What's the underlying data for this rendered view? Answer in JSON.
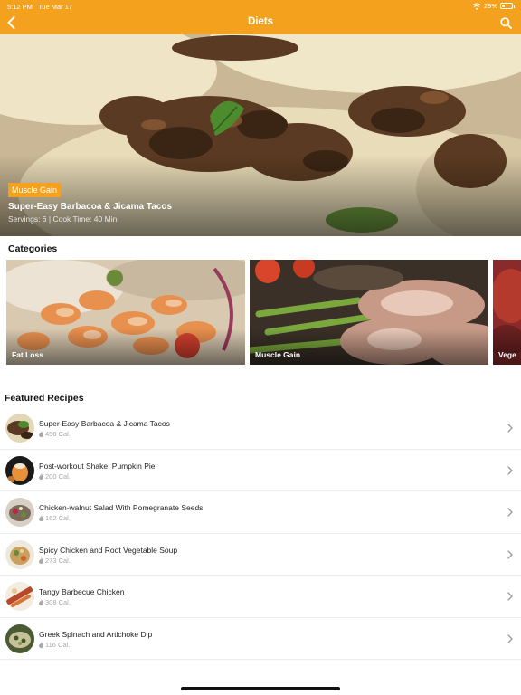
{
  "status_bar": {
    "time": "5:12 PM",
    "date": "Tue Mar 17",
    "battery": "29%",
    "battery_level": 0.29
  },
  "header": {
    "title": "Diets"
  },
  "featured": {
    "badge": "Muscle Gain",
    "title": "Super-Easy Barbacoa & Jicama Tacos",
    "meta": "Servings: 6 | Cook Time: 40 Min"
  },
  "categories": {
    "title": "Categories",
    "items": [
      {
        "label": "Fat Loss"
      },
      {
        "label": "Muscle Gain"
      },
      {
        "label": "Vege"
      }
    ]
  },
  "recipes": {
    "title": "Featured Recipes",
    "items": [
      {
        "name": "Super-Easy Barbacoa & Jicama Tacos",
        "calories": "456 Cal."
      },
      {
        "name": "Post-workout Shake: Pumpkin Pie",
        "calories": "200 Cal."
      },
      {
        "name": "Chicken-walnut Salad With Pomegranate Seeds",
        "calories": "162 Cal."
      },
      {
        "name": "Spicy Chicken and Root Vegetable Soup",
        "calories": "273 Cal."
      },
      {
        "name": "Tangy Barbecue Chicken",
        "calories": "308 Cal."
      },
      {
        "name": "Greek Spinach and Artichoke Dip",
        "calories": "116 Cal."
      }
    ]
  },
  "colors": {
    "accent": "#f4a21e",
    "text": "#111111",
    "muted": "#a8a8a8"
  },
  "icons": [
    "back-arrow-icon",
    "search-icon",
    "wifi-icon",
    "battery-icon",
    "flame-icon",
    "chevron-right-icon"
  ]
}
